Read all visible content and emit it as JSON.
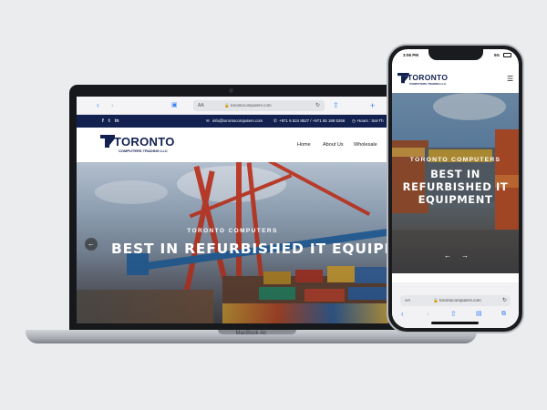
{
  "laptop": {
    "brand": "MacBook Air",
    "browser": {
      "url_aa": "AA",
      "url": "torontocomputers.com"
    },
    "topbar": {
      "social": [
        "f",
        "t",
        "in"
      ],
      "email": "info@torontocomputers.com",
      "phone": "+971 6 524 8527 / +971 55 188 5266",
      "hours": "Hours : Sat-Th"
    },
    "logo": {
      "name": "TORONTO",
      "tagline": "COMPUTERS TRADING LLC"
    },
    "nav": [
      "Home",
      "About Us",
      "Wholesale"
    ],
    "hero": {
      "subtitle": "TORONTO COMPUTERS",
      "title": "BEST IN REFURBISHED IT EQUIPMEN"
    }
  },
  "phone": {
    "status": {
      "time": "3:06 PM",
      "signal": "5G"
    },
    "logo": {
      "name": "TORONTO",
      "tagline": "COMPUTERS TRADING LLC"
    },
    "hero": {
      "subtitle": "TORONTO COMPUTERS",
      "title_lines": [
        "BEST IN",
        "REFURBISHED IT",
        "EQUIPMENT"
      ]
    },
    "browser": {
      "url_aa": "AA",
      "url": "torontocomputers.com"
    }
  },
  "colors": {
    "brand_navy": "#132150",
    "safari_blue": "#3b82f6",
    "background": "#ebecee"
  },
  "icons": [
    "back-icon",
    "share-icon",
    "tabs-icon",
    "reload-icon",
    "lock-icon",
    "menu-icon",
    "email-icon",
    "phone-icon",
    "clock-icon"
  ]
}
